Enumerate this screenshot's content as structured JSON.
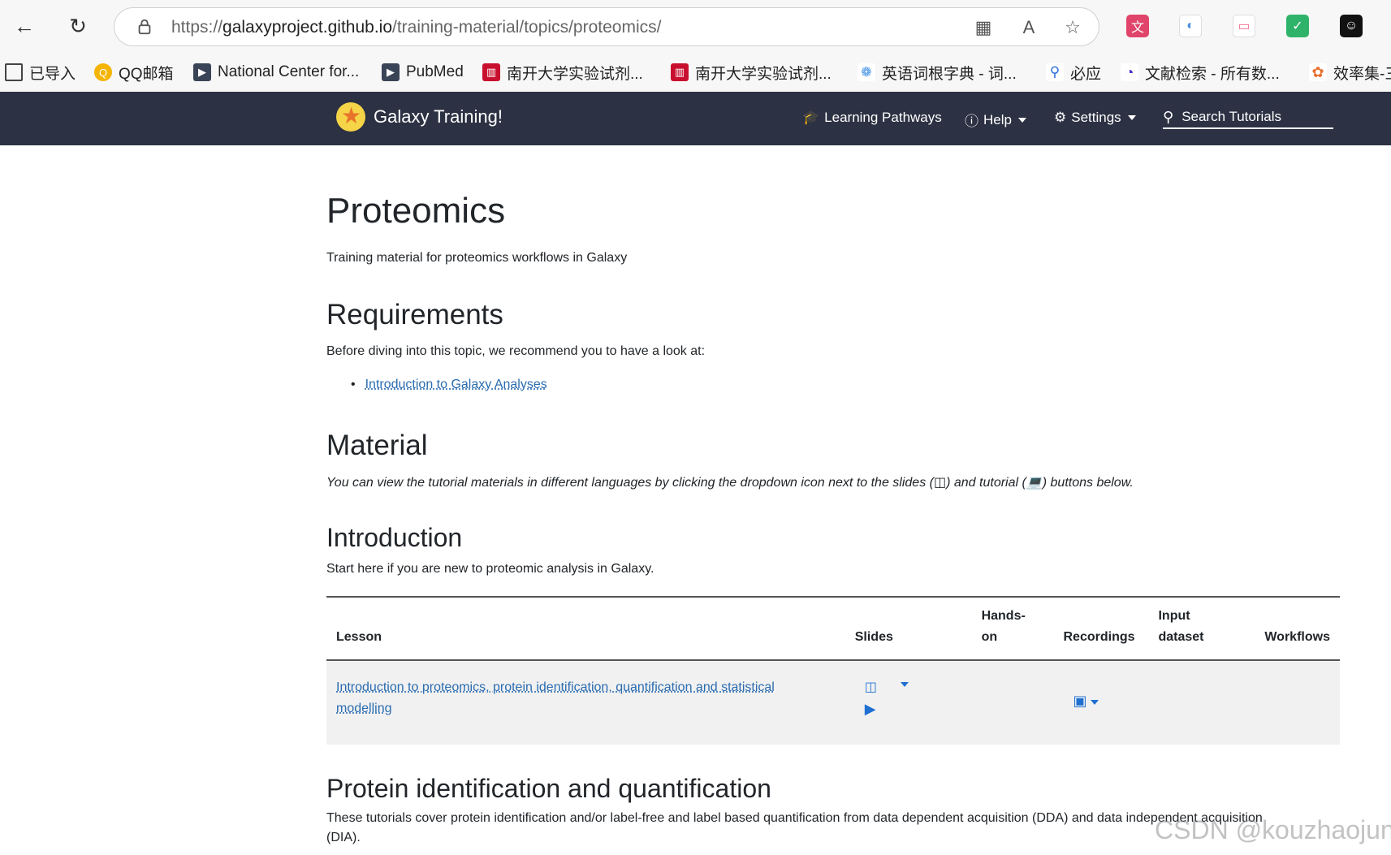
{
  "browser": {
    "url_prefix": "https://",
    "url_host": "galaxyproject.github.io",
    "url_path": "/training-material/topics/proteomics/",
    "bookmarks": [
      {
        "label": "已导入"
      },
      {
        "label": "QQ邮箱"
      },
      {
        "label": "National Center for..."
      },
      {
        "label": "PubMed"
      },
      {
        "label": "南开大学实验试剂..."
      },
      {
        "label": "南开大学实验试剂..."
      },
      {
        "label": "英语词根字典 - 词..."
      },
      {
        "label": "必应"
      },
      {
        "label": "文献检索 - 所有数..."
      },
      {
        "label": "效率集-三"
      }
    ]
  },
  "navbar": {
    "brand": "Galaxy Training!",
    "learning_pathways": "Learning Pathways",
    "help": "Help",
    "settings": "Settings",
    "search": "Search Tutorials"
  },
  "page": {
    "title": "Proteomics",
    "subtitle": "Training material for proteomics workflows in Galaxy",
    "requirements_heading": "Requirements",
    "requirements_intro": "Before diving into this topic, we recommend you to have a look at:",
    "requirements_link": "Introduction to Galaxy Analyses",
    "material_heading": "Material",
    "material_note_1": "You can view the tutorial materials in different languages by clicking the dropdown icon next to the slides (",
    "material_note_2": ") and tutorial (",
    "material_note_3": ") buttons below.",
    "intro_heading": "Introduction",
    "intro_text": "Start here if you are new to proteomic analysis in Galaxy.",
    "table_headers": {
      "lesson": "Lesson",
      "slides": "Slides",
      "hands_on_1": "Hands-",
      "hands_on_2": "on",
      "recordings": "Recordings",
      "input_1": "Input",
      "input_2": "dataset",
      "workflows": "Workflows"
    },
    "table_rows": [
      {
        "lesson_line1": "Introduction to proteomics, protein identification, quantification and statistical",
        "lesson_line2": "modelling"
      }
    ],
    "protein_heading": "Protein identification and quantification",
    "protein_text_1": "These tutorials cover protein identification and/or label-free and label based quantification from data dependent acquisition (DDA) and data independent acquisition",
    "protein_text_2": "(DIA).",
    "watermark": "CSDN @kouzhaojun"
  },
  "colors": {
    "navbar_bg": "#2c3143",
    "link": "#2b6cb0",
    "icon_blue": "#1f6fd1"
  }
}
